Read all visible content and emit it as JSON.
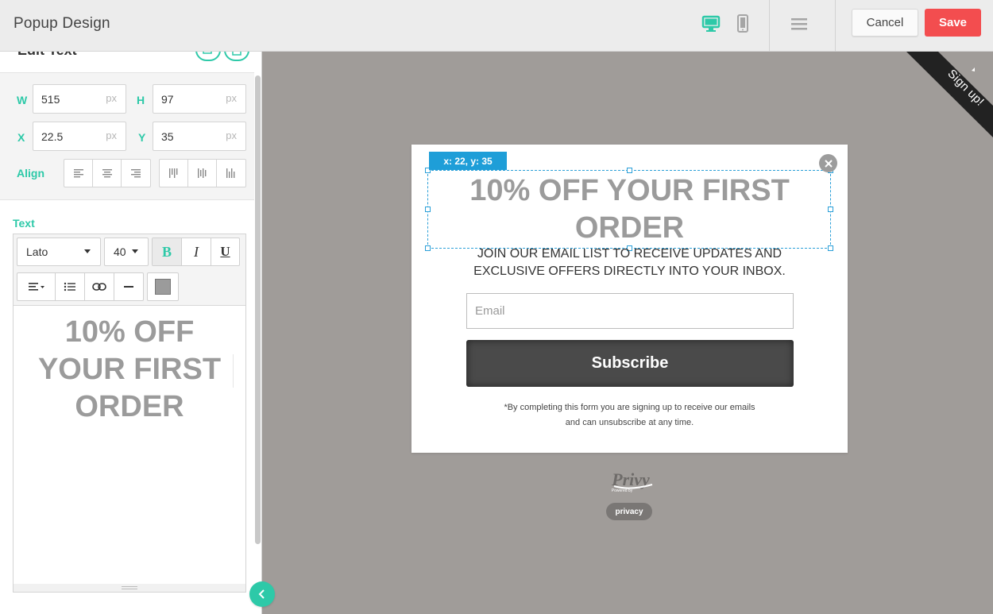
{
  "app": {
    "title": "Popup Design"
  },
  "toolbar": {
    "cancel_label": "Cancel",
    "save_label": "Save",
    "accent_color": "#2dc9a8",
    "save_color": "#f34d4f"
  },
  "sidebar": {
    "section_title": "Edit Text",
    "dimensions": {
      "w_label": "W",
      "w_value": "515",
      "w_unit": "px",
      "h_label": "H",
      "h_value": "97",
      "h_unit": "px",
      "x_label": "X",
      "x_value": "22.5",
      "x_unit": "px",
      "y_label": "Y",
      "y_value": "35",
      "y_unit": "px",
      "align_label": "Align"
    },
    "text_label": "Text",
    "editor": {
      "font": "Lato",
      "font_size": "40",
      "content": "10% OFF YOUR FIRST ORDER"
    }
  },
  "popup": {
    "coord_tag": "x: 22, y: 35",
    "headline": "10% OFF YOUR FIRST ORDER",
    "subtext_line1": "JOIN OUR EMAIL LIST TO RECEIVE UPDATES AND",
    "subtext_line2": "EXCLUSIVE OFFERS DIRECTLY INTO YOUR INBOX.",
    "email_placeholder": "Email",
    "subscribe_label": "Subscribe",
    "disclaimer_line1": "*By completing this form you are signing up to receive our emails",
    "disclaimer_line2": "and can unsubscribe at any time."
  },
  "canvas": {
    "ribbon_text": "Sign up!",
    "privy_label": "Privy",
    "powered_by": "Powered by",
    "privacy_label": "privacy"
  }
}
